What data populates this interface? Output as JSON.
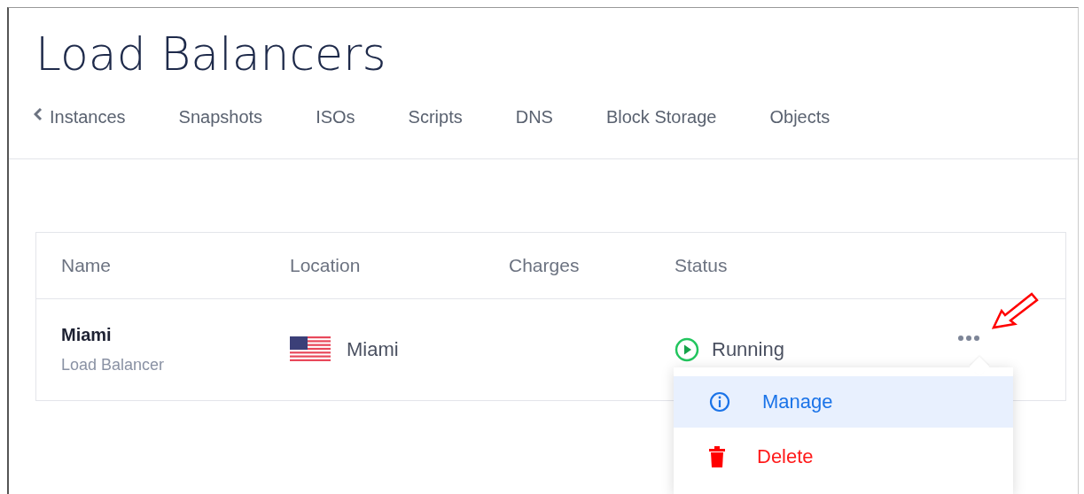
{
  "page": {
    "title": "Load Balancers"
  },
  "tabs": [
    {
      "label": "Instances",
      "back": true
    },
    {
      "label": "Snapshots",
      "back": false
    },
    {
      "label": "ISOs",
      "back": false
    },
    {
      "label": "Scripts",
      "back": false
    },
    {
      "label": "DNS",
      "back": false
    },
    {
      "label": "Block Storage",
      "back": false
    },
    {
      "label": "Objects",
      "back": false
    }
  ],
  "table": {
    "columns": [
      "Name",
      "Location",
      "Charges",
      "Status"
    ],
    "rows": [
      {
        "name": "Miami",
        "type": "Load Balancer",
        "location": "Miami",
        "status": "Running",
        "kind": "running"
      }
    ]
  },
  "menu": {
    "items": [
      {
        "label": "Manage",
        "kind": "info",
        "selected": true
      },
      {
        "label": "Delete",
        "kind": "delete",
        "selected": false
      }
    ]
  }
}
